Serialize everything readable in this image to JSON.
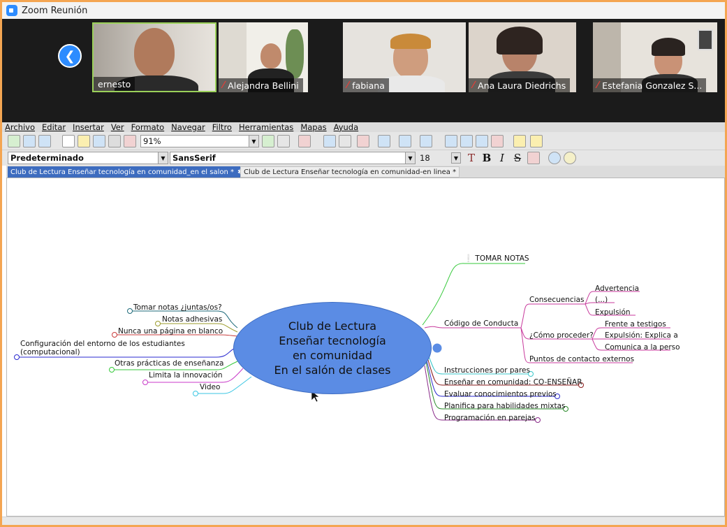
{
  "window": {
    "title": "Zoom Reunión"
  },
  "participants": [
    {
      "name": "ernesto",
      "muted": false
    },
    {
      "name": "Alejandra Bellini",
      "muted": true
    },
    {
      "name": "fabiana",
      "muted": true
    },
    {
      "name": "Ana Laura Diedrichs",
      "muted": true
    },
    {
      "name": "Estefania Gonzalez S...",
      "muted": true
    }
  ],
  "menu": [
    "Archivo",
    "Editar",
    "Insertar",
    "Ver",
    "Formato",
    "Navegar",
    "Filtro",
    "Herramientas",
    "Mapas",
    "Ayuda"
  ],
  "toolbar": {
    "zoom": "91%"
  },
  "format": {
    "style": "Predeterminado",
    "font": "SansSerif",
    "size": "18"
  },
  "tabs": [
    {
      "label": "Club de Lectura Enseñar tecnología en comunidad_en el salon *",
      "active": true
    },
    {
      "label": "Club de Lectura Enseñar tecnología en comunidad-en linea *",
      "active": false
    }
  ],
  "mindmap": {
    "center": [
      "Club de Lectura",
      "Enseñar tecnología",
      "en comunidad",
      "En el salón de clases"
    ],
    "right": {
      "tomar_notas": "TOMAR NOTAS",
      "codigo": "Código de Conducta",
      "consecuencias": "Consecuencias",
      "advertencia": "Advertencia",
      "ellipsis": "(...)",
      "expulsion": "Expulsión",
      "como_proceder": "¿Cómo proceder?",
      "frente_testigos": "Frente a testigos",
      "expulsion_explica": "Expulsión: Explica a",
      "comunica": "Comunica a la perso",
      "puntos": "Puntos de contacto externos",
      "instrucciones": "Instrucciones por pares",
      "ensenar": "Enseñar en comunidad: CO-ENSEÑAR",
      "evaluar": "Evaluar conocimientos previos",
      "planifica": "Planifica para habilidades mixtas",
      "programacion": "Programación en parejas"
    },
    "left": {
      "tomar_notas_juntas": "Tomar notas ¿juntas/os?",
      "notas_adhesivas": "Notas adhesivas",
      "nunca_pagina": "Nunca una página en blanco",
      "configuracion_1": "Configuración del entorno de los estudiantes",
      "configuracion_2": "(computacional)",
      "otras_practicas": "Otras prácticas de enseñanza",
      "limita": "Limita la innovación",
      "video": "Video"
    }
  }
}
